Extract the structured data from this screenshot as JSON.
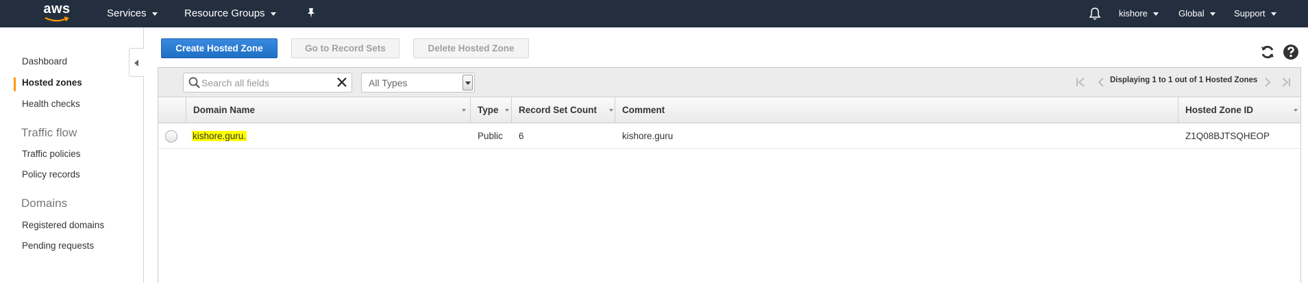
{
  "topnav": {
    "logo": "aws",
    "services": "Services",
    "resource_groups": "Resource Groups",
    "user": "kishore",
    "region": "Global",
    "support": "Support"
  },
  "sidebar": {
    "items": [
      {
        "label": "Dashboard"
      },
      {
        "label": "Hosted zones",
        "active": true
      },
      {
        "label": "Health checks"
      }
    ],
    "traffic_flow_heading": "Traffic flow",
    "traffic_flow_items": [
      {
        "label": "Traffic policies"
      },
      {
        "label": "Policy records"
      }
    ],
    "domains_heading": "Domains",
    "domains_items": [
      {
        "label": "Registered domains"
      },
      {
        "label": "Pending requests"
      }
    ]
  },
  "toolbar": {
    "create_label": "Create Hosted Zone",
    "goto_label": "Go to Record Sets",
    "delete_label": "Delete Hosted Zone"
  },
  "filter": {
    "search_placeholder": "Search all fields",
    "search_value": "",
    "type_value": "All Types"
  },
  "pagination": {
    "text": "Displaying 1 to 1 out of 1 Hosted Zones"
  },
  "table": {
    "columns": [
      "Domain Name",
      "Type",
      "Record Set Count",
      "Comment",
      "Hosted Zone ID"
    ],
    "rows": [
      {
        "domain": "kishore.guru.",
        "type": "Public",
        "record_set_count": "6",
        "comment": "kishore.guru",
        "zone_id": "Z1Q08BJTSQHEOP"
      }
    ]
  },
  "colors": {
    "nav_bg": "#232f3e",
    "primary_button": "#1f6fc5",
    "active_marker": "#ff9900",
    "highlight": "#ffff00"
  }
}
